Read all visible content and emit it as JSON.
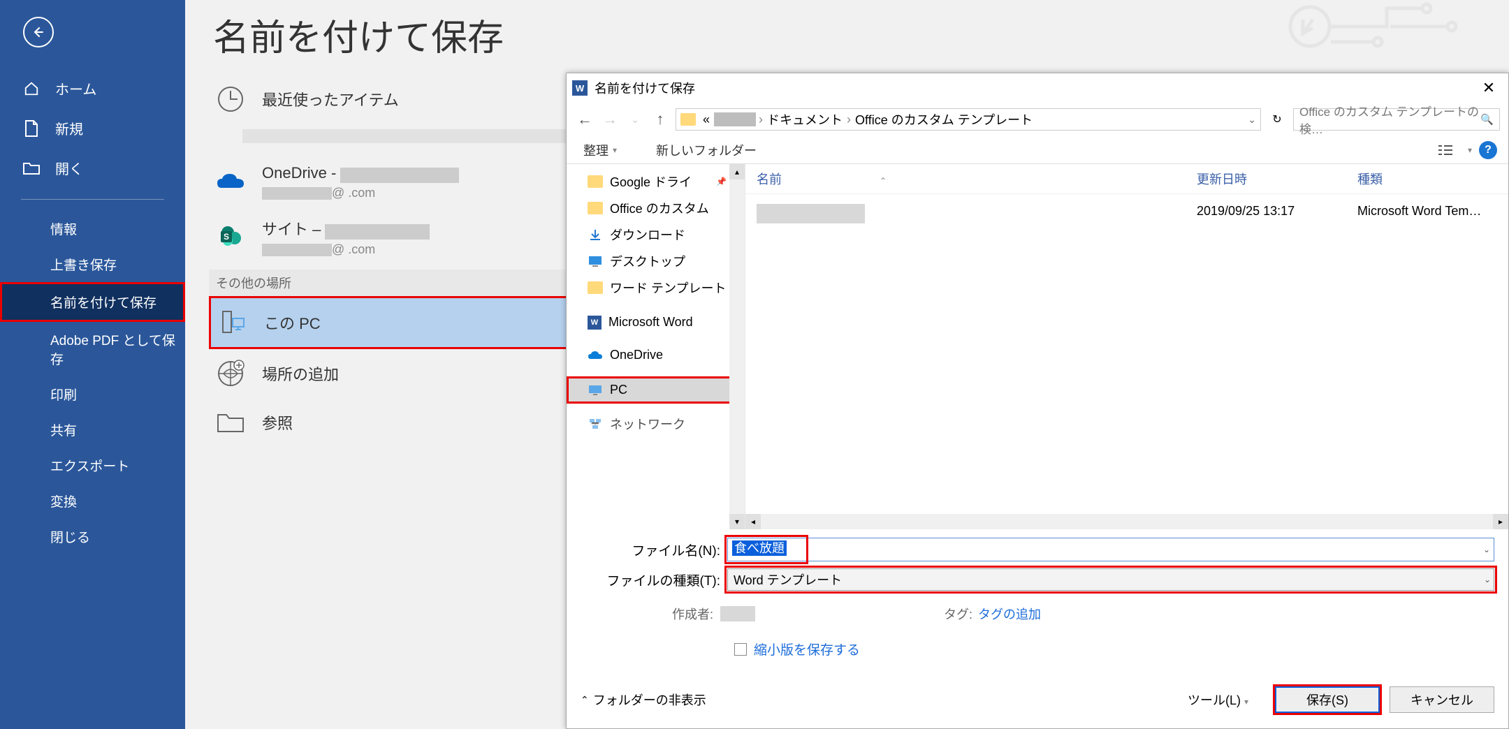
{
  "sidebar": {
    "back_label": "戻る",
    "items": {
      "home": "ホーム",
      "new": "新規",
      "open": "開く",
      "info": "情報",
      "save": "上書き保存",
      "save_as": "名前を付けて保存",
      "adobe": "Adobe PDF として保存",
      "print": "印刷",
      "share": "共有",
      "export": "エクスポート",
      "transform": "変換",
      "close": "閉じる"
    }
  },
  "page": {
    "title": "名前を付けて保存",
    "recent": "最近使ったアイテム",
    "onedrive_title": "OneDrive - ",
    "onedrive_sub": "@              .com",
    "site_title": "サイト – ",
    "site_sub": "@              .com",
    "other_locations": "その他の場所",
    "this_pc": "この PC",
    "add_location": "場所の追加",
    "browse": "参照"
  },
  "dialog": {
    "title": "名前を付けて保存",
    "breadcrumb": {
      "prefix": "«",
      "docs": "ドキュメント",
      "target": "Office のカスタム テンプレート"
    },
    "search_placeholder": "Office のカスタム テンプレートの検…",
    "toolbar": {
      "organize": "整理",
      "new_folder": "新しいフォルダー"
    },
    "tree": {
      "google_drive": "Google ドライ",
      "office_custom": "Office のカスタム ",
      "downloads": "ダウンロード",
      "desktop": "デスクトップ",
      "word_templates": "ワード テンプレート",
      "ms_word": "Microsoft Word",
      "onedrive": "OneDrive",
      "pc": "PC",
      "network": "ネットワーク"
    },
    "columns": {
      "name": "名前",
      "date": "更新日時",
      "type": "種類"
    },
    "files": [
      {
        "name": "",
        "date": "2019/09/25 13:17",
        "type": "Microsoft Word Tem…"
      }
    ],
    "form": {
      "filename_label": "ファイル名(N):",
      "filename_value": "食べ放題",
      "filetype_label": "ファイルの種類(T):",
      "filetype_value": "Word テンプレート",
      "author_label": "作成者:",
      "tag_label": "タグ:",
      "tag_add": "タグの追加",
      "save_thumbnail": "縮小版を保存する"
    },
    "footer": {
      "hide_folders": "フォルダーの非表示",
      "tools": "ツール(L)",
      "save": "保存(S)",
      "cancel": "キャンセル"
    }
  }
}
